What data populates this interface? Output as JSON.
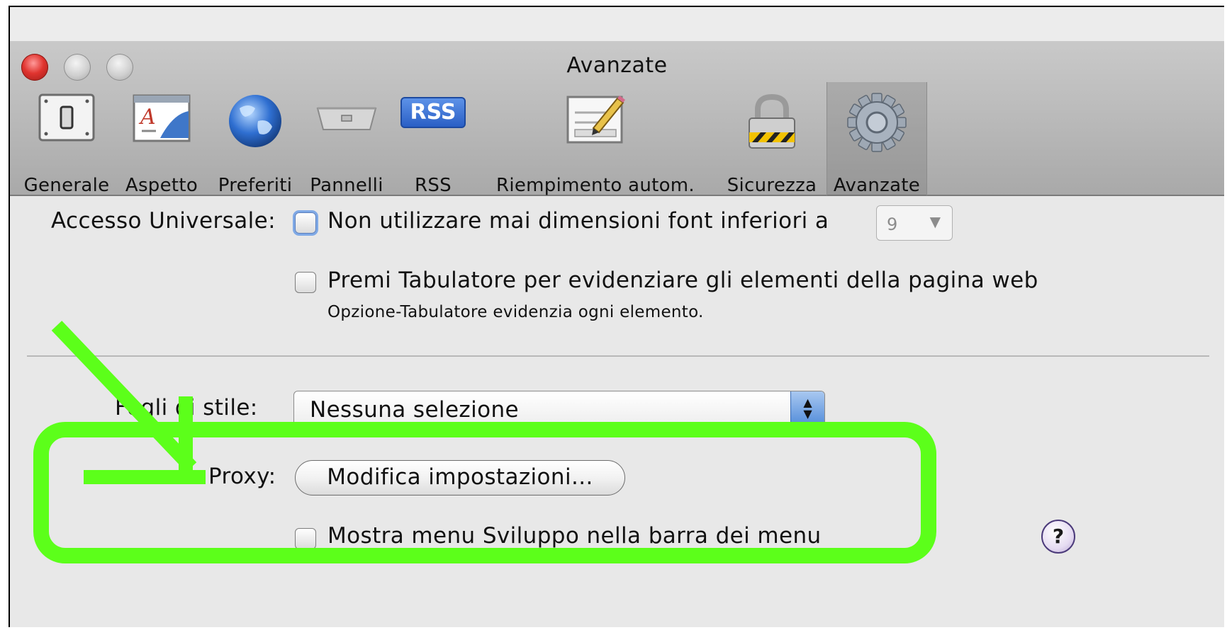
{
  "window": {
    "title": "Avanzate"
  },
  "toolbar": {
    "items": [
      {
        "label": "Generale"
      },
      {
        "label": "Aspetto"
      },
      {
        "label": "Preferiti"
      },
      {
        "label": "Pannelli"
      },
      {
        "label": "RSS",
        "icon_text": "RSS"
      },
      {
        "label": "Riempimento autom."
      },
      {
        "label": "Sicurezza"
      },
      {
        "label": "Avanzate"
      }
    ],
    "selected": "Avanzate"
  },
  "universal_access": {
    "label": "Accesso Universale:",
    "min_font_checkbox": {
      "label": "Non utilizzare mai dimensioni font inferiori a",
      "checked": false
    },
    "min_font_value": "9",
    "tab_checkbox": {
      "label": "Premi Tabulatore per evidenziare gli elementi della pagina web",
      "checked": false
    },
    "tab_note": "Opzione-Tabulatore evidenzia ogni elemento."
  },
  "style_sheet": {
    "label": "Fogli di stile:",
    "value": "Nessuna selezione"
  },
  "proxy": {
    "label": "Proxy:",
    "button_label": "Modifica impostazioni..."
  },
  "develop_menu": {
    "label": "Mostra menu Sviluppo nella barra dei menu",
    "checked": false
  },
  "help": {
    "symbol": "?"
  },
  "colors": {
    "annotation": "#5cff1a",
    "close_button": "#e0342f",
    "accent": "#4f8ad9"
  }
}
